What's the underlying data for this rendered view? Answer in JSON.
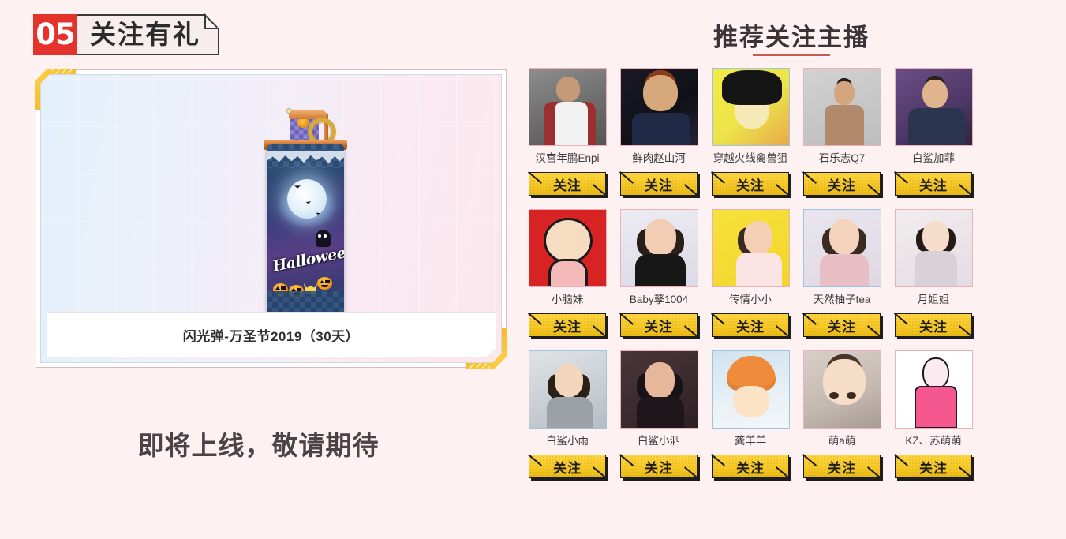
{
  "section": {
    "number": "05",
    "title": "关注有礼"
  },
  "prize": {
    "label": "闪光弹-万圣节2019（30天）",
    "artwork_wordmark": "Halloween",
    "icon": "halloween-flashbang-grenade"
  },
  "coming_soon": "即将上线，敬请期待",
  "recommend": {
    "title": "推荐关注主播",
    "underline_color": "#c85a55"
  },
  "follow_label": "关注",
  "colors": {
    "page_background": "#fdf1f1",
    "badge_red": "#e4332c",
    "button_yellow": "#f7c928",
    "button_outline": "#1d1d1d",
    "avatar_border_blue": "#9cc3e0",
    "avatar_border_pink": "#edb0b8",
    "title_text": "#3a3438"
  },
  "streamers": [
    [
      {
        "name": "汉宫年鹏Enpi",
        "avatar": "av-m1",
        "border": "pink-border"
      },
      {
        "name": "鲜肉赵山河",
        "avatar": "av-m2",
        "border": "pink-border"
      },
      {
        "name": "穿越火线禽兽狙",
        "avatar": "av-m3",
        "border": ""
      },
      {
        "name": "石乐志Q7",
        "avatar": "av-m4",
        "border": "pink-border"
      },
      {
        "name": "白鲨加菲",
        "avatar": "av-m5",
        "border": "pink-border"
      }
    ],
    [
      {
        "name": "小脑妹",
        "avatar": "av-c1",
        "border": "pink-border"
      },
      {
        "name": "Baby孳1004",
        "avatar": "av-w1",
        "border": "pink-border"
      },
      {
        "name": "传情小小",
        "avatar": "av-w2",
        "border": "pink-border"
      },
      {
        "name": "天然柚子tea",
        "avatar": "av-w3",
        "border": ""
      },
      {
        "name": "月姐姐",
        "avatar": "av-w4",
        "border": "pink-border"
      }
    ],
    [
      {
        "name": "白鲨小雨",
        "avatar": "av-g1",
        "border": ""
      },
      {
        "name": "白鲨小泗",
        "avatar": "av-g2",
        "border": "pink-border"
      },
      {
        "name": "龚羊羊",
        "avatar": "av-g3",
        "border": ""
      },
      {
        "name": "萌a萌",
        "avatar": "av-g4",
        "border": "pink-border"
      },
      {
        "name": "KZ、苏萌萌",
        "avatar": "av-g5",
        "border": "pink-border"
      }
    ]
  ]
}
